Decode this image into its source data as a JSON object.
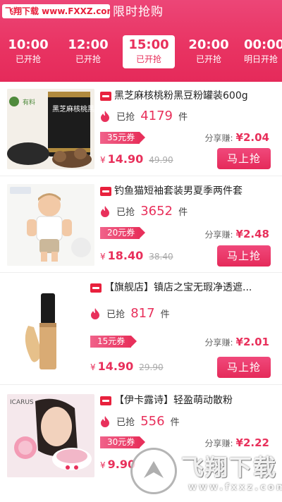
{
  "watermark_top": "飞翔下载 www.FXXZ.com",
  "page_title": "限时抢购",
  "colors": {
    "accent": "#e8305b",
    "header": "#e93463"
  },
  "tabs": [
    {
      "time": "10:00",
      "status": "已开抢"
    },
    {
      "time": "12:00",
      "status": "已开抢"
    },
    {
      "time": "15:00",
      "status": "已开抢",
      "active": true
    },
    {
      "time": "20:00",
      "status": "已开抢"
    },
    {
      "time": "00:00",
      "status": "明日开抢"
    }
  ],
  "products": [
    {
      "title": "黑芝麻核桃粉黑豆粉罐装600g",
      "sold_label": "已抢",
      "sold": "4179",
      "unit": "件",
      "coupon": "35元券",
      "share_label": "分享赚:",
      "share_amount": "¥2.04",
      "currency": "¥",
      "price": "14.90",
      "orig_price": "49.90",
      "button": "马上抢",
      "thumb_brand": "有料",
      "thumb_can_text": "黑芝麻核桃黑豆粉"
    },
    {
      "title": "钓鱼猫短袖套装男夏季两件套",
      "sold_label": "已抢",
      "sold": "3652",
      "unit": "件",
      "coupon": "20元券",
      "share_label": "分享赚:",
      "share_amount": "¥2.48",
      "currency": "¥",
      "price": "18.40",
      "orig_price": "38.40",
      "button": "马上抢"
    },
    {
      "title": "【旗舰店】镇店之宝无瑕净透遮...",
      "sold_label": "已抢",
      "sold": "817",
      "unit": "件",
      "coupon": "15元券",
      "share_label": "分享赚:",
      "share_amount": "¥2.01",
      "currency": "¥",
      "price": "14.90",
      "orig_price": "29.90",
      "button": "马上抢"
    },
    {
      "title": "【伊卡露诗】轻盈萌动散粉",
      "sold_label": "已抢",
      "sold": "556",
      "unit": "件",
      "coupon": "30元券",
      "share_label": "分享赚:",
      "share_amount": "¥2.22",
      "currency": "¥",
      "price": "9.90",
      "orig_price": "",
      "button": "马上抢",
      "thumb_brand": "ICARUS"
    }
  ],
  "watermark_bottom": {
    "text": "飞翔下载",
    "url": "www.fxxz.com"
  }
}
